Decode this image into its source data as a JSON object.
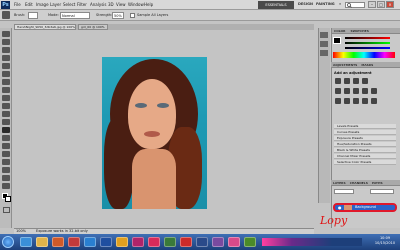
{
  "app": {
    "logo": "Ps"
  },
  "menu": [
    "File",
    "Edit",
    "Image",
    "Layer",
    "Select",
    "Filter",
    "Analysis",
    "3D",
    "View",
    "Window",
    "Help"
  ],
  "workspace": {
    "active": "ESSENTIALS",
    "design": "DESIGN",
    "painting": "PAINTING",
    "more": "»",
    "search_icon": "search-icon"
  },
  "window_controls": {
    "minimize": "–",
    "maximize": "□",
    "close": "×"
  },
  "options": {
    "brush_label": "Brush:",
    "mode_label": "Mode:",
    "mode_value": "Normal",
    "strength_label": "Strength:",
    "strength_value": "50%",
    "sample_label": "Sample All Layers"
  },
  "doc_tabs": [
    "HarshNight_SK50_3db3a6.jpg @ 100%",
    "girl_00 @ 100%"
  ],
  "panels": {
    "color_tab": "COLOR",
    "swatches_tab": "SWATCHES",
    "adjustments_tab": "ADJUSTMENTS",
    "masks_tab": "MASKS",
    "add_adjustment": "Add an adjustment",
    "presets": [
      "Levels Presets",
      "Curves Presets",
      "Exposure Presets",
      "Hue/Saturation Presets",
      "Black & White Presets",
      "Channel Mixer Presets",
      "Selective Color Presets"
    ],
    "layers_tab": "LAYERS",
    "channels_tab": "CHANNELS",
    "paths_tab": "PATHS"
  },
  "layers": [
    {
      "name": "Background"
    }
  ],
  "status": {
    "zoom": "100%",
    "text": "Exposure works in 32-bit only"
  },
  "taskbar": {
    "time": "10:09",
    "date": "10/15/2010"
  },
  "signature": "Lopy",
  "colors": {
    "taskbar": "#1d3f7a",
    "layer_selected": "#2b63c8",
    "highlight_ring": "#e0182a",
    "photo_bg": "#2aa8be"
  }
}
